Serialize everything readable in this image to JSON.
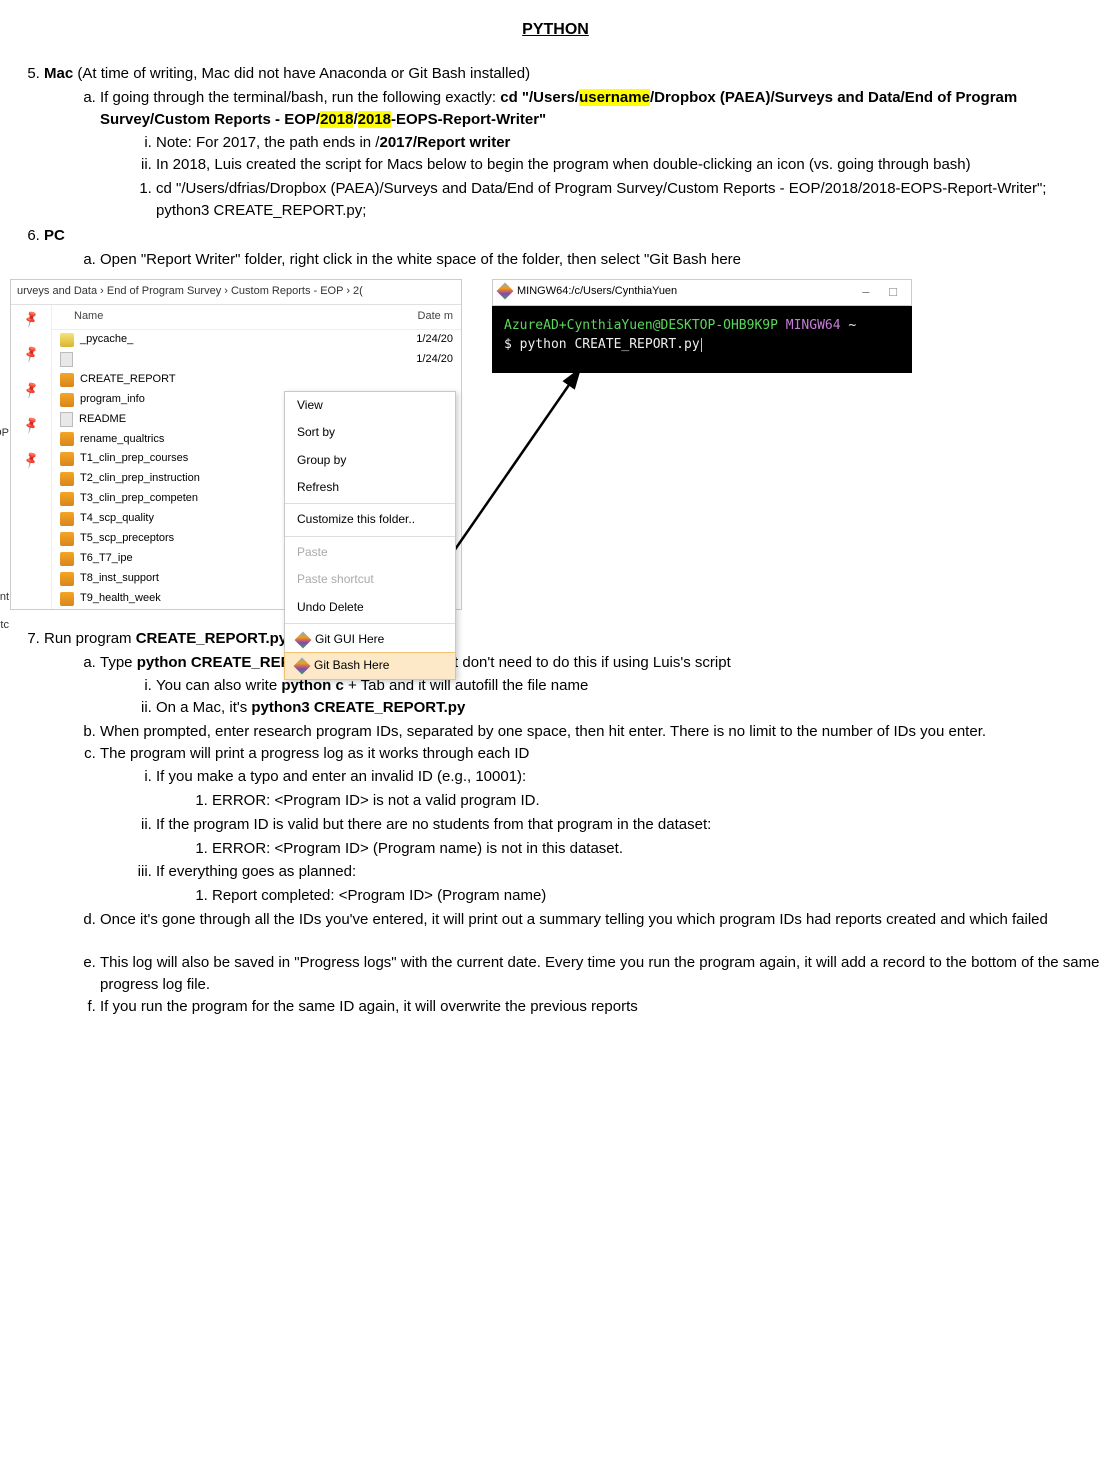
{
  "title": "PYTHON",
  "item5": {
    "lead_bold": "Mac",
    "lead_rest": " (At time of writing, Mac did not have Anaconda or Git Bash installed)",
    "a_pre": "If going through the terminal/bash, run the following exactly: ",
    "a_cmd_1": "cd \"/Users/",
    "a_hl1": "username",
    "a_cmd_2": "/Dropbox (PAEA)/Surveys and Data/End of Program Survey/Custom Reports - EOP/",
    "a_hl2": "2018",
    "a_cmd_3": "/",
    "a_hl3": "2018",
    "a_cmd_4": "-EOPS-Report-Writer\"",
    "i_text": "Note: For 2017, the path ends in /",
    "i_bold": "2017/Report writer",
    "ii": "In 2018, Luis created the script for Macs below to begin the program when double-clicking an icon (vs. going through bash)",
    "one": "cd \"/Users/dfrias/Dropbox (PAEA)/Surveys and Data/End of Program Survey/Custom Reports - EOP/2018/2018-EOPS-Report-Writer\"; python3 CREATE_REPORT.py;"
  },
  "item6": {
    "head": "PC",
    "a": "Open \"Report Writer\" folder, right click in the white space of the folder, then select \"Git Bash here"
  },
  "explorer": {
    "breadcrumb": "urveys and Data  ›  End of Program Survey  ›  Custom Reports - EOP  ›  2(",
    "col_name": "Name",
    "col_date": "Date m",
    "left_label1": "OP",
    "left_label2": "pment",
    "left_label3": "s, etc",
    "files": [
      {
        "icon": "folder",
        "name": "_pycache_",
        "date": "1/24/20"
      },
      {
        "icon": "doc",
        "name": "",
        "date": "1/24/20"
      },
      {
        "icon": "py",
        "name": "CREATE_REPORT",
        "date": ""
      },
      {
        "icon": "py",
        "name": "program_info",
        "date": ""
      },
      {
        "icon": "doc",
        "name": "README",
        "date": ""
      },
      {
        "icon": "py",
        "name": "rename_qualtrics",
        "date": ""
      },
      {
        "icon": "py",
        "name": "T1_clin_prep_courses",
        "date": ""
      },
      {
        "icon": "py",
        "name": "T2_clin_prep_instruction",
        "date": ""
      },
      {
        "icon": "py",
        "name": "T3_clin_prep_competen",
        "date": ""
      },
      {
        "icon": "py",
        "name": "T4_scp_quality",
        "date": ""
      },
      {
        "icon": "py",
        "name": "T5_scp_preceptors",
        "date": ""
      },
      {
        "icon": "py",
        "name": "T6_T7_ipe",
        "date": ""
      },
      {
        "icon": "py",
        "name": "T8_inst_support",
        "date": ""
      },
      {
        "icon": "py",
        "name": "T9_health_week",
        "date": ""
      }
    ],
    "menu": {
      "view": "View",
      "sort": "Sort by",
      "group": "Group by",
      "refresh": "Refresh",
      "customize": "Customize this folder..",
      "paste": "Paste",
      "paste_sc": "Paste shortcut",
      "undo": "Undo Delete",
      "gitgui": "Git GUI Here",
      "gitbash": "Git Bash Here"
    }
  },
  "terminal": {
    "title": "MINGW64:/c/Users/CynthiaYuen",
    "prompt_user": "AzureAD+CynthiaYuen@DESKTOP-OHB9K9P",
    "prompt_mingw": " MINGW64 ",
    "tilde": "~",
    "line2": "$ python CREATE_REPORT.py"
  },
  "item7": {
    "lead_pre": "Run program ",
    "lead_bold": "CREATE_REPORT.py",
    "a_pre": "Type ",
    "a_bold": "python CREATE_REPORT.py",
    "a_post": " and hit enter, but don't need to do this if using Luis's script",
    "ai_pre": "You can also write ",
    "ai_bold": "python c",
    "ai_post": " + Tab and it will autofill the file name",
    "aii_pre": "On a Mac, it's ",
    "aii_bold": "python3 CREATE_REPORT.py",
    "b": "When prompted, enter research program IDs, separated by one space, then hit enter. There is no limit to the number of IDs you enter.",
    "c": "The program will print a progress log as it works through each ID",
    "ci": "If you make a typo and enter an invalid ID (e.g., 10001):",
    "ci1": "ERROR: <Program ID> is not a valid program ID.",
    "cii": "If the program ID is valid but there are no students from that program in the dataset:",
    "cii1": "ERROR: <Program ID> (Program name) is not in this dataset.",
    "ciii": "If everything goes as planned:",
    "ciii1": "Report completed: <Program ID> (Program name)",
    "d": "Once it's gone through all the IDs you've entered, it will print out a summary telling you which program IDs had reports created and which failed",
    "e": "This log will also be saved in \"Progress logs\" with the current date. Every time you run the program again, it will add a record to the bottom of the same progress log file.",
    "f": "If you run the program for the same ID again, it will overwrite the previous reports"
  }
}
